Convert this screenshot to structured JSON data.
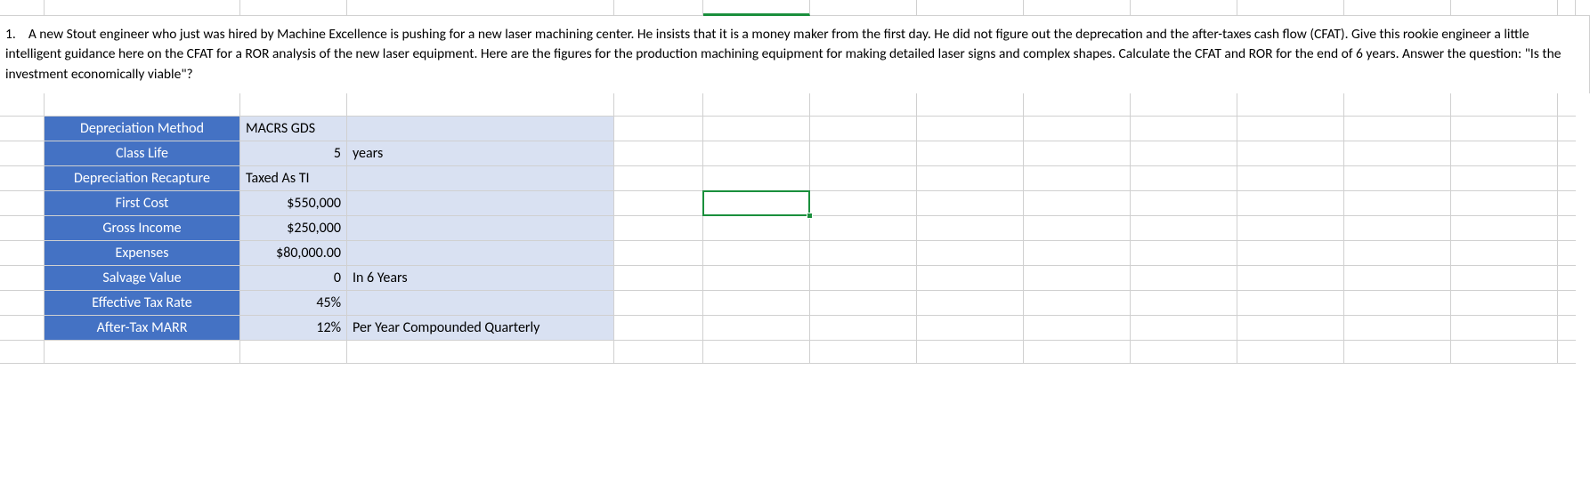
{
  "question": {
    "number": "1.",
    "text": "A new Stout engineer who just was hired by Machine Excellence is pushing for a new laser machining center. He insists that it is a money maker from the first day.  He did not figure out the deprecation and the after-taxes cash flow (CFAT). Give this rookie engineer a little intelligent guidance here on the CFAT for a ROR analysis of the new laser equipment. Here are the figures for the production machining equipment for making detailed laser signs and complex shapes. Calculate the CFAT and ROR for the end of 6 years.  Answer the question: \"Is the investment economically viable\"?"
  },
  "table": {
    "rows": [
      {
        "label": "Depreciation Method",
        "value": "MACRS GDS",
        "extra": "",
        "align": "left"
      },
      {
        "label": "Class Life",
        "value": "5",
        "extra": "years",
        "align": "right"
      },
      {
        "label": "Depreciation Recapture",
        "value": "Taxed As TI",
        "extra": "",
        "align": "left"
      },
      {
        "label": "First Cost",
        "value": "$550,000",
        "extra": "",
        "align": "right"
      },
      {
        "label": "Gross Income",
        "value": "$250,000",
        "extra": "",
        "align": "right"
      },
      {
        "label": "Expenses",
        "value": "$80,000.00",
        "extra": "",
        "align": "right"
      },
      {
        "label": "Salvage Value",
        "value": "0",
        "extra": "In 6 Years",
        "align": "right"
      },
      {
        "label": "Effective Tax Rate",
        "value": "45%",
        "extra": "",
        "align": "right"
      },
      {
        "label": "After-Tax MARR",
        "value": "12%",
        "extra": "Per Year Compounded Quarterly",
        "align": "right"
      }
    ]
  },
  "chart_data": {
    "type": "table",
    "title": "Laser Machining Center CFAT/ROR Inputs",
    "parameters": {
      "depreciation_method": "MACRS GDS",
      "class_life_years": 5,
      "depreciation_recapture": "Taxed As TI",
      "first_cost_usd": 550000,
      "gross_income_usd": 250000,
      "expenses_usd": 80000.0,
      "salvage_value_usd": 0,
      "salvage_at_year": 6,
      "effective_tax_rate": 0.45,
      "after_tax_marr": 0.12,
      "marr_compounding": "quarterly"
    }
  }
}
